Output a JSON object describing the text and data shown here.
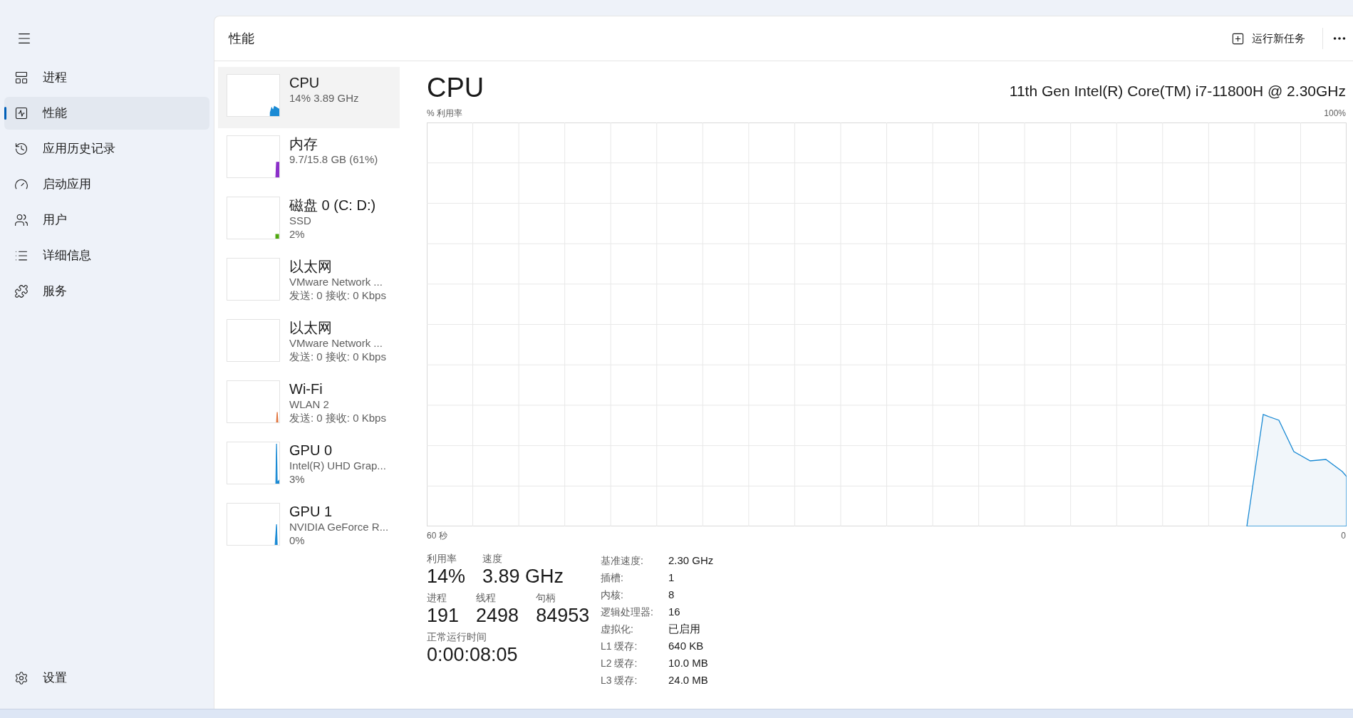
{
  "sidebar": {
    "items": [
      {
        "label": "进程",
        "selected": false
      },
      {
        "label": "性能",
        "selected": true
      },
      {
        "label": "应用历史记录",
        "selected": false
      },
      {
        "label": "启动应用",
        "selected": false
      },
      {
        "label": "用户",
        "selected": false
      },
      {
        "label": "详细信息",
        "selected": false
      },
      {
        "label": "服务",
        "selected": false
      }
    ],
    "footer": {
      "label": "设置"
    }
  },
  "header": {
    "title": "性能",
    "run_task": "运行新任务"
  },
  "devices": [
    {
      "name": "CPU",
      "lines": [
        "14%  3.89 GHz"
      ],
      "color": "#1a8ad4",
      "selected": true
    },
    {
      "name": "内存",
      "lines": [
        "9.7/15.8 GB (61%)"
      ],
      "color": "#8b2fc9",
      "selected": false
    },
    {
      "name": "磁盘 0 (C: D:)",
      "lines": [
        "SSD",
        "2%"
      ],
      "color": "#4da60c",
      "selected": false
    },
    {
      "name": "以太网",
      "lines": [
        "VMware Network ...",
        "发送: 0 接收: 0 Kbps"
      ],
      "selected": false
    },
    {
      "name": "以太网",
      "lines": [
        "VMware Network ...",
        "发送: 0 接收: 0 Kbps"
      ],
      "selected": false
    },
    {
      "name": "Wi-Fi",
      "lines": [
        "WLAN 2",
        "发送: 0 接收: 0 Kbps"
      ],
      "color": "#e0723a",
      "selected": false
    },
    {
      "name": "GPU 0",
      "lines": [
        "Intel(R) UHD Grap...",
        "3%"
      ],
      "color": "#1a8ad4",
      "selected": false
    },
    {
      "name": "GPU 1",
      "lines": [
        "NVIDIA GeForce R...",
        "0%"
      ],
      "color": "#1a8ad4",
      "selected": false
    }
  ],
  "detail": {
    "title": "CPU",
    "model": "11th Gen Intel(R) Core(TM) i7-11800H @ 2.30GHz",
    "graph": {
      "y_label": "% 利用率",
      "y_max": "100%",
      "x_start": "60 秒",
      "x_end": "0"
    },
    "stats": [
      [
        {
          "label": "利用率",
          "value": "14%"
        },
        {
          "label": "速度",
          "value": "3.89 GHz"
        }
      ],
      [
        {
          "label": "进程",
          "value": "191"
        },
        {
          "label": "线程",
          "value": "2498"
        },
        {
          "label": "句柄",
          "value": "84953"
        }
      ],
      [
        {
          "label": "正常运行时间",
          "value": "0:00:08:05"
        }
      ]
    ],
    "specs": [
      {
        "label": "基准速度:",
        "value": "2.30 GHz"
      },
      {
        "label": "插槽:",
        "value": "1"
      },
      {
        "label": "内核:",
        "value": "8"
      },
      {
        "label": "逻辑处理器:",
        "value": "16"
      },
      {
        "label": "虚拟化:",
        "value": "已启用"
      },
      {
        "label": "L1 缓存:",
        "value": "640 KB"
      },
      {
        "label": "L2 缓存:",
        "value": "10.0 MB"
      },
      {
        "label": "L3 缓存:",
        "value": "24.0 MB"
      }
    ]
  }
}
